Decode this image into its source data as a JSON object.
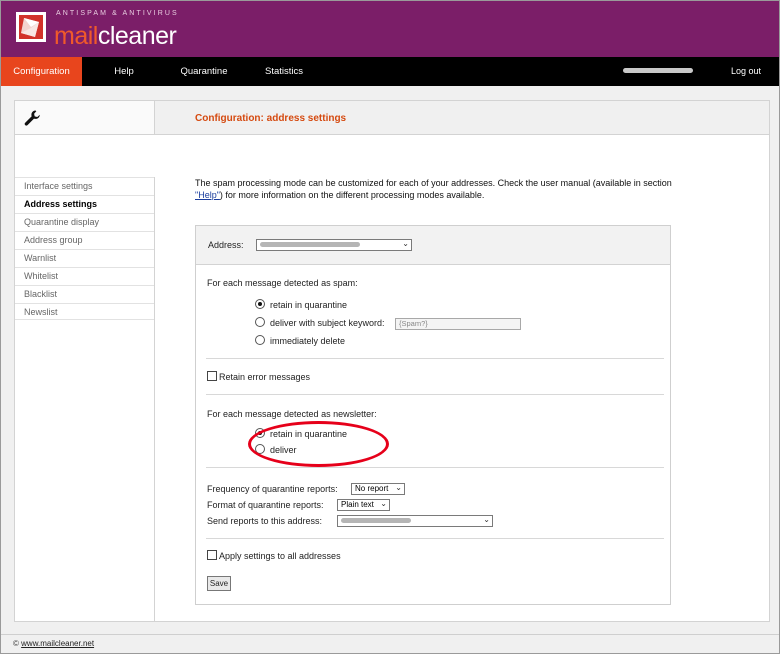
{
  "header": {
    "tagline": "ANTISPAM & ANTIVIRUS",
    "brand_accent": "mail",
    "brand_rest": "cleaner"
  },
  "nav": {
    "items": [
      {
        "label": "Configuration",
        "active": true
      },
      {
        "label": "Help"
      },
      {
        "label": "Quarantine"
      },
      {
        "label": "Statistics"
      }
    ],
    "logout": "Log out"
  },
  "page": {
    "title": "Configuration: address settings",
    "intro_before": "The spam processing mode can be customized for each of your addresses. Check the user manual (available in section ",
    "intro_link": "\"Help\"",
    "intro_after": ") for more information on the different processing modes available."
  },
  "sidebar": {
    "items": [
      {
        "label": "Interface settings"
      },
      {
        "label": "Address settings",
        "active": true
      },
      {
        "label": "Quarantine display"
      },
      {
        "label": "Address group"
      },
      {
        "label": "Warnlist"
      },
      {
        "label": "Whitelist"
      },
      {
        "label": "Blacklist"
      },
      {
        "label": "Newslist"
      }
    ]
  },
  "settings": {
    "address_label": "Address:",
    "spam": {
      "heading": "For each message detected as spam:",
      "options": [
        {
          "label": "retain in quarantine",
          "checked": true
        },
        {
          "label": "deliver with subject keyword:",
          "checked": false
        },
        {
          "label": "immediately delete",
          "checked": false
        }
      ],
      "keyword_value": "{Spam?}"
    },
    "retain_errors": {
      "label": "Retain error messages",
      "checked": false
    },
    "newsletter": {
      "heading": "For each message detected as newsletter:",
      "options": [
        {
          "label": "retain in quarantine",
          "checked": true
        },
        {
          "label": "deliver",
          "checked": false
        }
      ]
    },
    "reports": {
      "frequency_label": "Frequency of quarantine reports:",
      "frequency_value": "No report",
      "format_label": "Format of quarantine reports:",
      "format_value": "Plain text",
      "send_label": "Send reports to this address:"
    },
    "apply_all": {
      "label": "Apply settings to all addresses",
      "checked": false
    },
    "save_label": "Save"
  },
  "footer": {
    "copyright": "©",
    "link": "www.mailcleaner.net"
  },
  "colors": {
    "header": "#7b1e68",
    "accent": "#e8451d",
    "title": "#d54a10",
    "annotation": "#e6001a"
  }
}
